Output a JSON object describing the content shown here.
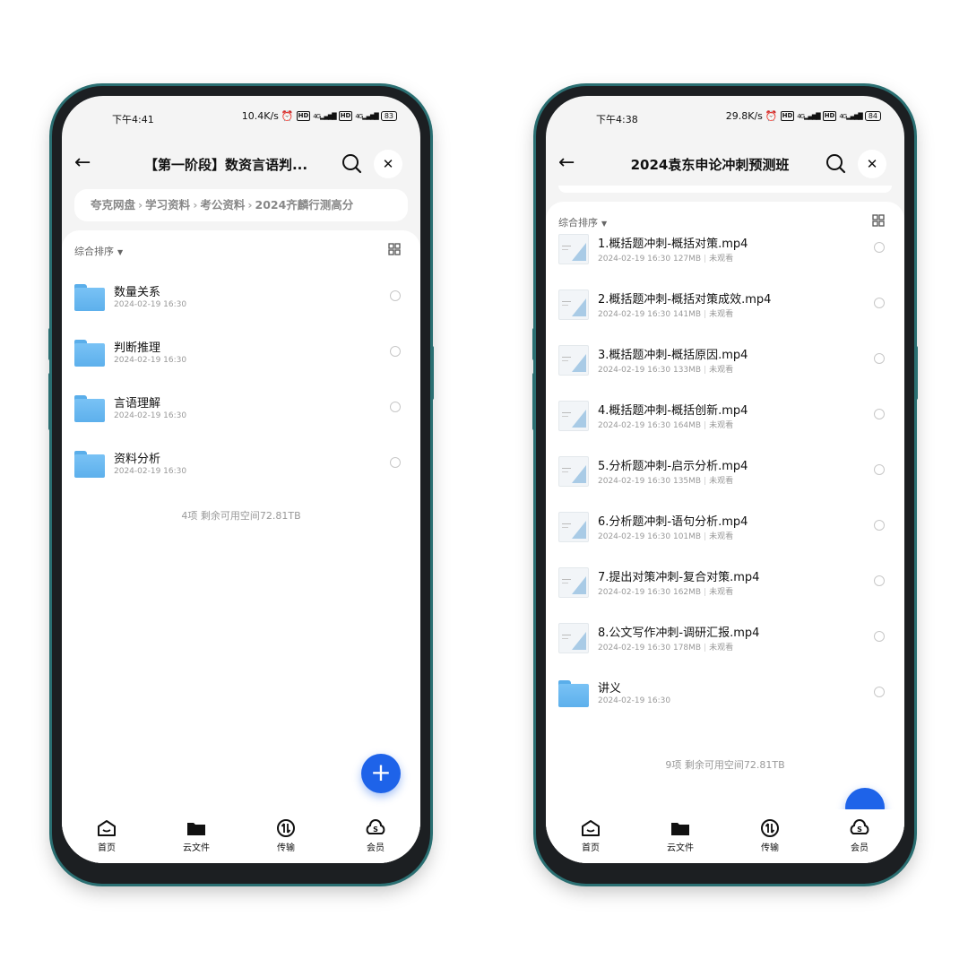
{
  "left_phone": {
    "status": {
      "time": "下午4:41",
      "speed": "10.4K/s",
      "network": "4G",
      "battery": "83"
    },
    "header": {
      "title": "【第一阶段】数资言语判..."
    },
    "breadcrumb": [
      "夸克网盘",
      "学习资料",
      "考公资料",
      "2024齐麟行测高分"
    ],
    "sort_label": "综合排序",
    "items": [
      {
        "name": "数量关系",
        "date": "2024-02-19 16:30"
      },
      {
        "name": "判断推理",
        "date": "2024-02-19 16:30"
      },
      {
        "name": "言语理解",
        "date": "2024-02-19 16:30"
      },
      {
        "name": "资料分析",
        "date": "2024-02-19 16:30"
      }
    ],
    "footer": "4项 剩余可用空间72.81TB",
    "fab": "+"
  },
  "right_phone": {
    "status": {
      "time": "下午4:38",
      "speed": "29.8K/s",
      "network": "4G",
      "battery": "84"
    },
    "header": {
      "title": "2024袁东申论冲刺预测班"
    },
    "sort_label": "综合排序",
    "items": [
      {
        "name": "1.概括题冲刺-概括对策.mp4",
        "date": "2024-02-19 16:30",
        "size": "127MB",
        "watch": "未观看"
      },
      {
        "name": "2.概括题冲刺-概括对策成效.mp4",
        "date": "2024-02-19 16:30",
        "size": "141MB",
        "watch": "未观看"
      },
      {
        "name": "3.概括题冲刺-概括原因.mp4",
        "date": "2024-02-19 16:30",
        "size": "133MB",
        "watch": "未观看"
      },
      {
        "name": "4.概括题冲刺-概括创新.mp4",
        "date": "2024-02-19 16:30",
        "size": "164MB",
        "watch": "未观看"
      },
      {
        "name": "5.分析题冲刺-启示分析.mp4",
        "date": "2024-02-19 16:30",
        "size": "135MB",
        "watch": "未观看"
      },
      {
        "name": "6.分析题冲刺-语句分析.mp4",
        "date": "2024-02-19 16:30",
        "size": "101MB",
        "watch": "未观看"
      },
      {
        "name": "7.提出对策冲刺-复合对策.mp4",
        "date": "2024-02-19 16:30",
        "size": "162MB",
        "watch": "未观看"
      },
      {
        "name": "8.公文写作冲刺-调研汇报.mp4",
        "date": "2024-02-19 16:30",
        "size": "178MB",
        "watch": "未观看"
      },
      {
        "name": "讲义",
        "date": "2024-02-19 16:30"
      }
    ],
    "footer": "9项 剩余可用空间72.81TB"
  },
  "tabbar": [
    {
      "label": "首页",
      "icon": "home-icon"
    },
    {
      "label": "云文件",
      "icon": "folder-icon"
    },
    {
      "label": "传输",
      "icon": "transfer-icon"
    },
    {
      "label": "会员",
      "icon": "vip-icon"
    }
  ],
  "colors": {
    "accent": "#1e63e9",
    "folder": "#6bb8f1"
  }
}
